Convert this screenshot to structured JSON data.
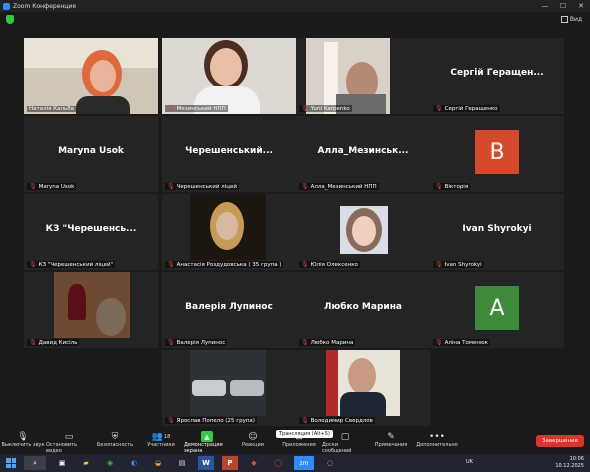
{
  "window": {
    "title": "Zoom Конференция",
    "view_label": "Вид"
  },
  "participants": [
    {
      "name": "Наталія Кальба",
      "display": "",
      "muted": false,
      "kind": "video",
      "active": true
    },
    {
      "name": "Мезинський НПП",
      "display": "",
      "muted": true,
      "kind": "video"
    },
    {
      "name": "Yurii Karpenko",
      "display": "",
      "muted": true,
      "kind": "video"
    },
    {
      "name": "Сергій Геращенко",
      "display": "Сергій Геращен...",
      "muted": true,
      "kind": "name"
    },
    {
      "name": "Maryna Usok",
      "display": "Maryna Usok",
      "muted": true,
      "kind": "name"
    },
    {
      "name": "Черешенський ліцей",
      "display": "Черешенський...",
      "muted": true,
      "kind": "name"
    },
    {
      "name": "Алла_Мезинський НПП",
      "display": "Алла_Мезинськ...",
      "muted": true,
      "kind": "name"
    },
    {
      "name": "Вікторія",
      "display": "B",
      "muted": true,
      "kind": "avatar",
      "color": "#d64a2b"
    },
    {
      "name": "КЗ \"Черешенський ліцей\"",
      "display": "КЗ \"Черешенсь...",
      "muted": true,
      "kind": "name"
    },
    {
      "name": "Анастасія Роздудовська ( 35 група )",
      "display": "",
      "muted": true,
      "kind": "video"
    },
    {
      "name": "Юлія Олексенко",
      "display": "",
      "muted": true,
      "kind": "video"
    },
    {
      "name": "Ivan Shyrokyi",
      "display": "Ivan Shyrokyi",
      "muted": true,
      "kind": "name"
    },
    {
      "name": "Давид Кисіль",
      "display": "",
      "muted": true,
      "kind": "video"
    },
    {
      "name": "Валерія Лупинос",
      "display": "Валерія Лупинос",
      "muted": true,
      "kind": "name"
    },
    {
      "name": "Любко Марина",
      "display": "Любко Марина",
      "muted": true,
      "kind": "name"
    },
    {
      "name": "Аліна Томенюк",
      "display": "A",
      "muted": true,
      "kind": "avatar",
      "color": "#3c8a3a"
    },
    {
      "name": "Ярослав Попело (25 група)",
      "display": "",
      "muted": true,
      "kind": "video"
    },
    {
      "name": "Володимир Свердлов",
      "display": "",
      "muted": true,
      "kind": "video"
    }
  ],
  "toolbar": {
    "mute": "Выключить звук",
    "video": "Остановить видео",
    "security": "Безопасность",
    "participants": "Участники",
    "participants_count": "18",
    "share": "Демонстрация экрана",
    "reactions": "Реакции",
    "apps": "Приложения",
    "whiteboards": "Доски сообщений",
    "notes": "Примечания",
    "more": "Дополнительно",
    "end": "Завершение",
    "tooltip": "Трансляция (Alt+S)"
  },
  "taskbar": {
    "lang": "UK",
    "time": "10:06",
    "date": "10.12.2025"
  }
}
